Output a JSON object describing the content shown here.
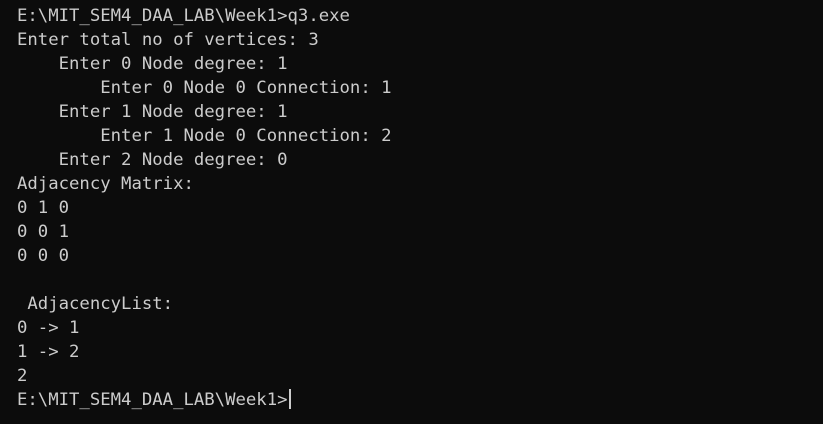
{
  "terminal": {
    "lines": [
      "E:\\MIT_SEM4_DAA_LAB\\Week1>q3.exe",
      "Enter total no of vertices: 3",
      "    Enter 0 Node degree: 1",
      "        Enter 0 Node 0 Connection: 1",
      "    Enter 1 Node degree: 1",
      "        Enter 1 Node 0 Connection: 2",
      "    Enter 2 Node degree: 0",
      "Adjacency Matrix:",
      "0 1 0",
      "0 0 1",
      "0 0 0",
      "",
      " AdjacencyList:",
      "0 -> 1",
      "1 -> 2",
      "2"
    ],
    "prompt": "E:\\MIT_SEM4_DAA_LAB\\Week1>"
  },
  "colors": {
    "background": "#0c0c0c",
    "foreground": "#cccccc"
  }
}
